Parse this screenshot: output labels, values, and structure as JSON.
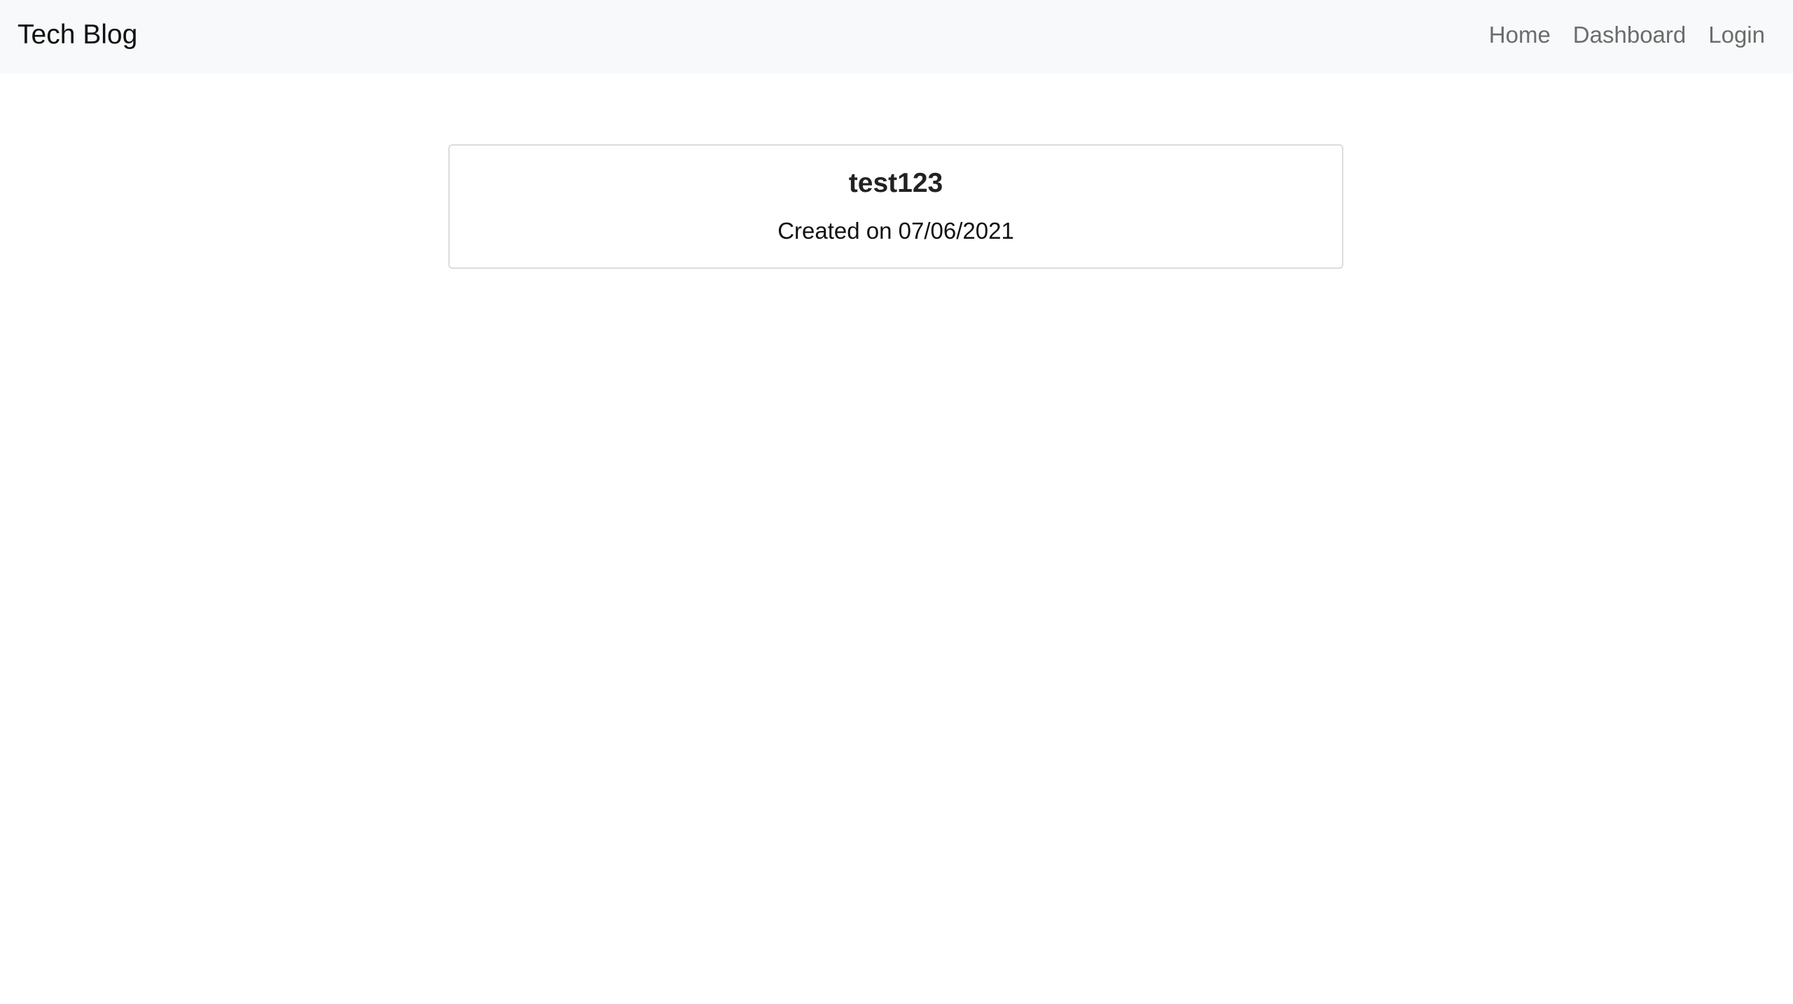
{
  "navbar": {
    "brand": "Tech Blog",
    "links": [
      {
        "label": "Home"
      },
      {
        "label": "Dashboard"
      },
      {
        "label": "Login"
      }
    ]
  },
  "post": {
    "title": "test123",
    "created": "Created on 07/06/2021"
  },
  "colors": {
    "navbar_bg": "#f8f9fa",
    "nav_link": "#6c6c6c",
    "card_border": "#dcdcdc"
  }
}
